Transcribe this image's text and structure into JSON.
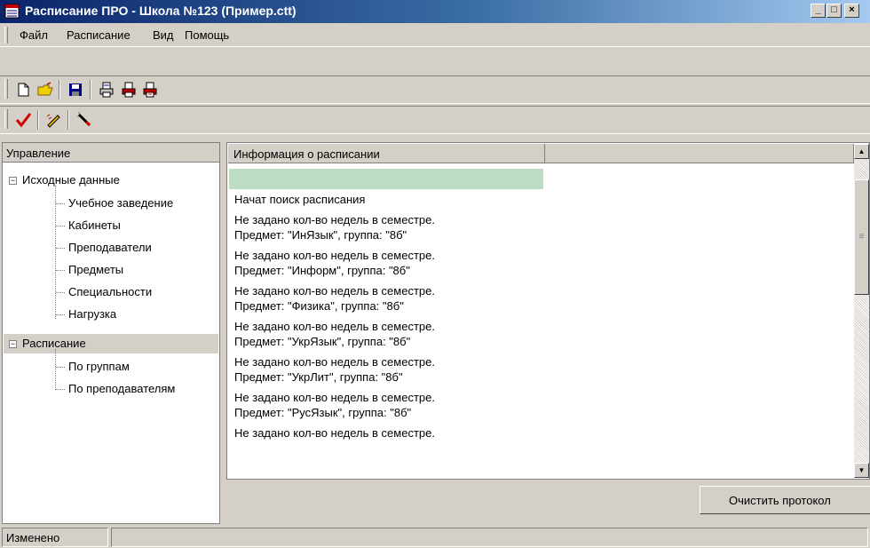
{
  "window": {
    "title": "Расписание ПРО - Школа №123 (Пример.ctt)",
    "minimize": "_",
    "maximize": "□",
    "close": "×"
  },
  "menu": [
    "Файл",
    "Расписание",
    "Вид",
    "Помощь"
  ],
  "toolbar1_icons": [
    "new-document-icon",
    "open-folder-icon",
    "save-icon",
    "print-icon",
    "print-red-icon",
    "print-red-alt-icon"
  ],
  "toolbar2_icons": [
    "checkmark-icon",
    "edit-pen-icon",
    "magic-wand-icon"
  ],
  "left_panel": {
    "header": "Управление",
    "groups": [
      {
        "label": "Исходные данные",
        "expander": "−",
        "children": [
          "Учебное заведение",
          "Кабинеты",
          "Преподаватели",
          "Предметы",
          "Специальности",
          "Нагрузка"
        ]
      },
      {
        "label": "Расписание",
        "expander": "−",
        "children": [
          "По группам",
          "По преподавателям"
        ]
      }
    ]
  },
  "log": {
    "column_header": "Информация о расписании",
    "highlighted_row": "",
    "entries": [
      [
        "Начат поиск расписания"
      ],
      [
        "Не задано кол-во недель в семестре.",
        "Предмет: \"ИнЯзык\", группа: \"8б\""
      ],
      [
        "Не задано кол-во недель в семестре.",
        "Предмет: \"Информ\", группа: \"8б\""
      ],
      [
        "Не задано кол-во недель в семестре.",
        "Предмет: \"Физика\", группа: \"8б\""
      ],
      [
        "Не задано кол-во недель в семестре.",
        "Предмет: \"УкрЯзык\", группа: \"8б\""
      ],
      [
        "Не задано кол-во недель в семестре.",
        "Предмет: \"УкрЛит\", группа: \"8б\""
      ],
      [
        "Не задано кол-во недель в семестре.",
        "Предмет: \"РусЯзык\", группа: \"8б\""
      ],
      [
        "Не задано кол-во недель в семестре."
      ]
    ],
    "clear_button": "Очистить протокол"
  },
  "status": {
    "state": "Изменено"
  },
  "colors": {
    "highlight": "#bcdcc4",
    "title_gradient_start": "#0a246a",
    "title_gradient_end": "#a6caf0"
  }
}
